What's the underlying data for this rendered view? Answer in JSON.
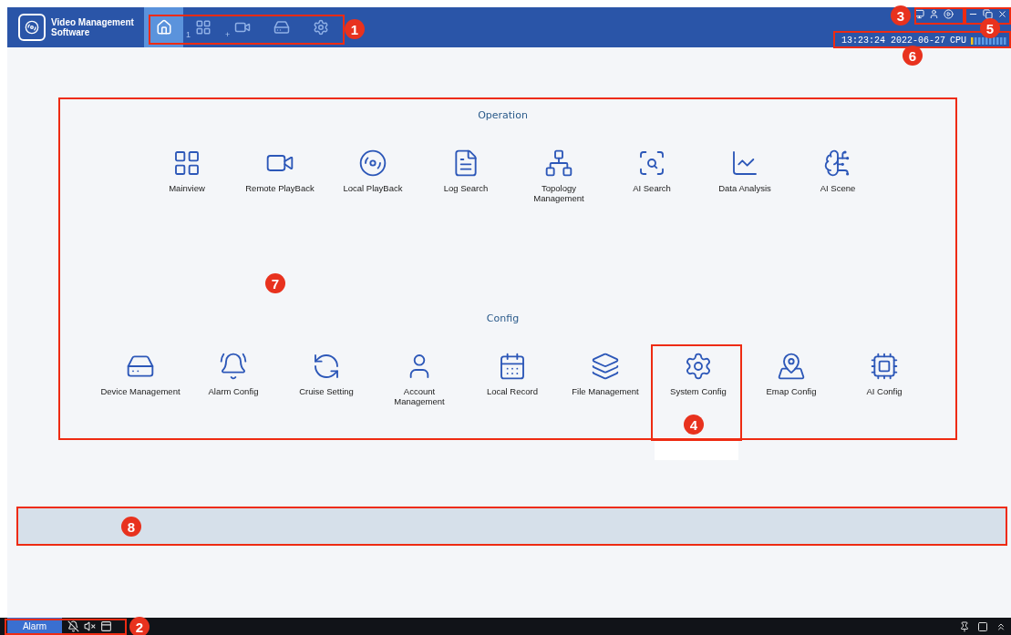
{
  "app": {
    "title_line_1": "Video Management",
    "title_line_2": "Software"
  },
  "nav_tabs": [
    {
      "kind": "home",
      "selected": true
    },
    {
      "kind": "grid",
      "selected": false,
      "sub": "1"
    },
    {
      "kind": "video",
      "selected": false,
      "sub": "+"
    },
    {
      "kind": "device",
      "selected": false
    },
    {
      "kind": "settings",
      "selected": false
    }
  ],
  "status": {
    "datetime": "13:23:24 2022-06-27",
    "cpu_label": "CPU"
  },
  "sections": [
    {
      "title": "Operation",
      "items": [
        {
          "kind": "mainview",
          "label": "Mainview"
        },
        {
          "kind": "remote",
          "label": "Remote PlayBack"
        },
        {
          "kind": "local_playback",
          "label": "Local PlayBack"
        },
        {
          "kind": "log",
          "label": "Log Search"
        },
        {
          "kind": "topology",
          "label": "Topology Management"
        },
        {
          "kind": "ai_search",
          "label": "AI Search"
        },
        {
          "kind": "data",
          "label": "Data Analysis"
        },
        {
          "kind": "ai_scene",
          "label": "AI Scene"
        }
      ]
    },
    {
      "title": "Config",
      "items": [
        {
          "kind": "device",
          "label": "Device Management"
        },
        {
          "kind": "alarm",
          "label": "Alarm Config"
        },
        {
          "kind": "cruise",
          "label": "Cruise Setting"
        },
        {
          "kind": "account",
          "label": "Account Management"
        },
        {
          "kind": "record",
          "label": "Local Record"
        },
        {
          "kind": "file",
          "label": "File Management"
        },
        {
          "kind": "system",
          "label": "System Config"
        },
        {
          "kind": "emap",
          "label": "Emap Config"
        },
        {
          "kind": "ai_config",
          "label": "AI Config"
        }
      ]
    }
  ],
  "bottom_bar": {
    "alarm_button": "Alarm"
  },
  "callouts": [
    "1",
    "2",
    "3",
    "4",
    "5",
    "6",
    "7",
    "8"
  ]
}
